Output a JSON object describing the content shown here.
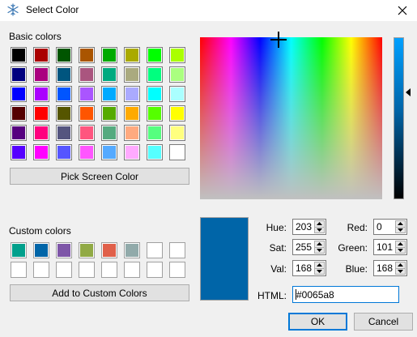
{
  "window": {
    "title": "Select Color",
    "close_icon": "close-icon"
  },
  "basic_colors": {
    "label": "Basic colors",
    "rows": [
      [
        "#000000",
        "#aa0000",
        "#005500",
        "#aa5500",
        "#00aa00",
        "#aaaa00",
        "#00ff00",
        "#aaff00"
      ],
      [
        "#00007f",
        "#aa007f",
        "#00557f",
        "#aa557f",
        "#00aa7f",
        "#aaaa7f",
        "#00ff7f",
        "#aaff7f"
      ],
      [
        "#0000ff",
        "#aa00ff",
        "#0055ff",
        "#aa55ff",
        "#00aaff",
        "#aaaaff",
        "#00ffff",
        "#aaffff"
      ],
      [
        "#550000",
        "#ff0000",
        "#555500",
        "#ff5500",
        "#55aa00",
        "#ffaa00",
        "#55ff00",
        "#ffff00"
      ],
      [
        "#55007f",
        "#ff007f",
        "#55557f",
        "#ff557f",
        "#55aa7f",
        "#ffaa7f",
        "#55ff7f",
        "#ffff7f"
      ],
      [
        "#5500ff",
        "#ff00ff",
        "#5555ff",
        "#ff55ff",
        "#55aaff",
        "#ffaaff",
        "#55ffff",
        "#ffffff"
      ]
    ]
  },
  "pick_screen_color_label": "Pick Screen Color",
  "custom_colors": {
    "label": "Custom colors",
    "rows": [
      [
        "#00a08c",
        "#0065a8",
        "#7e56a8",
        "#91aa45",
        "#e0604a",
        "#91aaaa",
        "#ffffff",
        "#ffffff"
      ],
      [
        "#ffffff",
        "#ffffff",
        "#ffffff",
        "#ffffff",
        "#ffffff",
        "#ffffff",
        "#ffffff",
        "#ffffff"
      ]
    ]
  },
  "add_to_custom_label": "Add to Custom Colors",
  "current_color": "#0065a8",
  "fields": {
    "hue_label": "Hue:",
    "hue": "203",
    "sat_label": "Sat:",
    "sat": "255",
    "val_label": "Val:",
    "val": "168",
    "red_label": "Red:",
    "red": "0",
    "green_label": "Green:",
    "green": "101",
    "blue_label": "Blue:",
    "blue": "168",
    "html_label": "HTML:",
    "html": "#0065a8"
  },
  "buttons": {
    "ok": "OK",
    "cancel": "Cancel"
  }
}
